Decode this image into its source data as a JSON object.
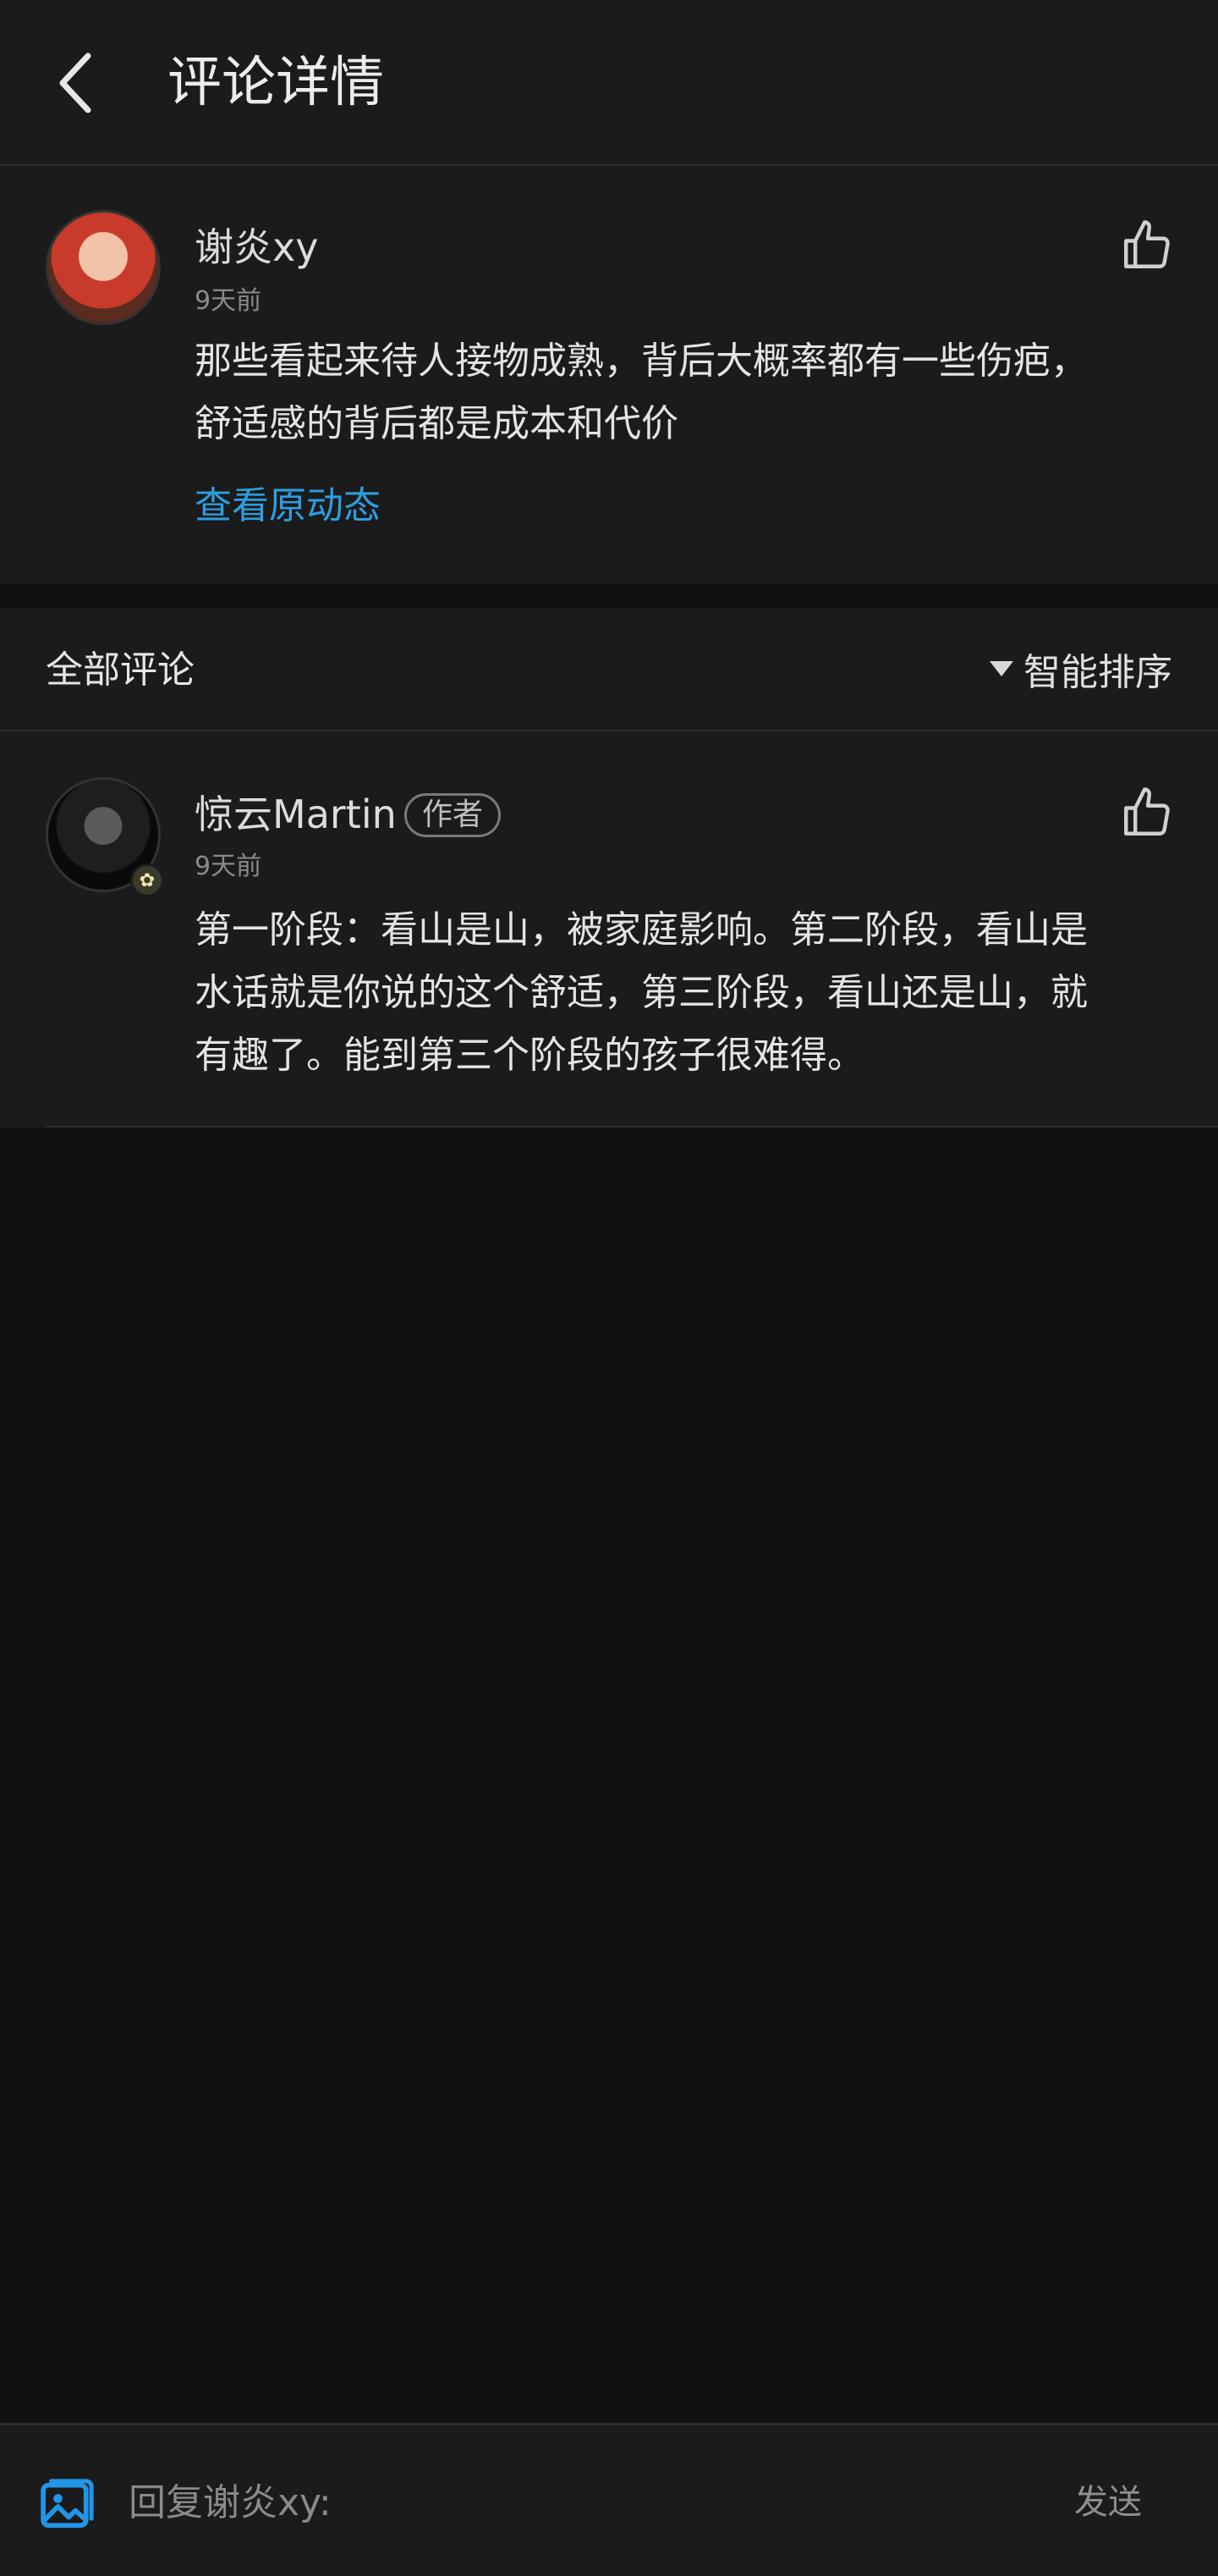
{
  "header": {
    "title": "评论详情"
  },
  "original_comment": {
    "username": "谢炎xy",
    "time": "9天前",
    "content_line1": "那些看起来待人接物成熟，背后大概率都有一些伤疤，",
    "content_line2": "舒适感的背后都是成本和代价",
    "view_original": "查看原动态"
  },
  "comments_section": {
    "title": "全部评论",
    "sort_label": "智能排序"
  },
  "replies": [
    {
      "username": "惊云Martin",
      "tag": "作者",
      "time": "9天前",
      "line1": "第一阶段：看山是山，被家庭影响。第二阶段，看山是",
      "line2": "水话就是你说的这个舒适，第三阶段，看山还是山，就",
      "line3": "有趣了。能到第三个阶段的孩子很难得。"
    }
  ],
  "input_bar": {
    "placeholder": "回复谢炎xy:",
    "send_label": "发送"
  },
  "colors": {
    "accent_link": "#2d9ee0",
    "background": "#101010",
    "card": "#1b1b1b"
  }
}
